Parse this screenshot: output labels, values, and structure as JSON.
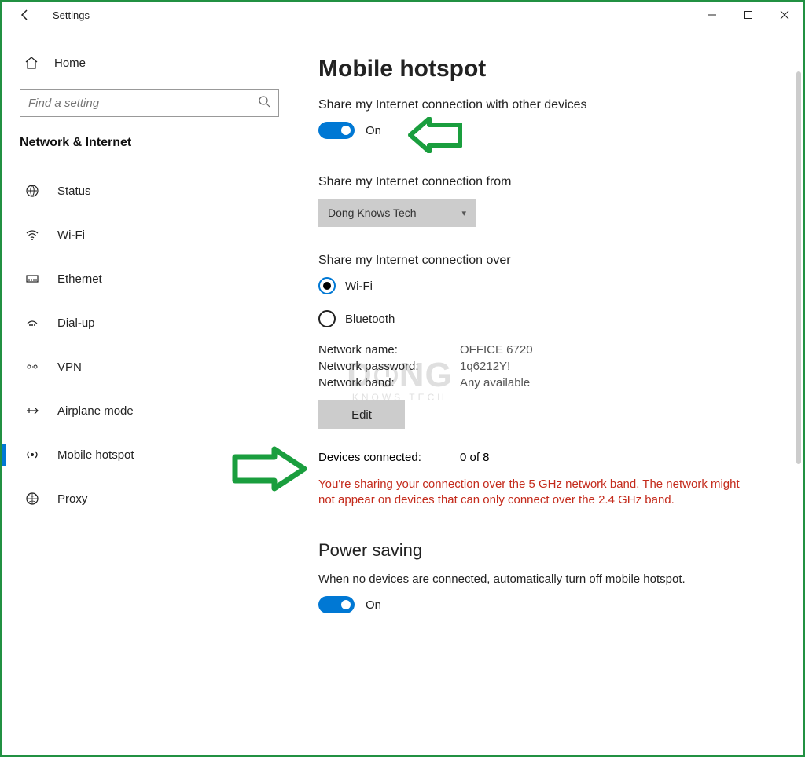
{
  "titlebar": {
    "title": "Settings"
  },
  "sidebar": {
    "home": "Home",
    "search_placeholder": "Find a setting",
    "category": "Network & Internet",
    "items": [
      {
        "label": "Status"
      },
      {
        "label": "Wi-Fi"
      },
      {
        "label": "Ethernet"
      },
      {
        "label": "Dial-up"
      },
      {
        "label": "VPN"
      },
      {
        "label": "Airplane mode"
      },
      {
        "label": "Mobile hotspot"
      },
      {
        "label": "Proxy"
      }
    ]
  },
  "main": {
    "heading": "Mobile hotspot",
    "share_label": "Share my Internet connection with other devices",
    "share_toggle_state": "On",
    "from_label": "Share my Internet connection from",
    "from_value": "Dong Knows Tech",
    "over_label": "Share my Internet connection over",
    "radio_wifi": "Wi-Fi",
    "radio_bluetooth": "Bluetooth",
    "net_name_k": "Network name:",
    "net_name_v": "OFFICE 6720",
    "net_pass_k": "Network password:",
    "net_pass_v": "1q6212Y!",
    "net_band_k": "Network band:",
    "net_band_v": "Any available",
    "edit_label": "Edit",
    "devices_k": "Devices connected:",
    "devices_v": "0 of 8",
    "warning": "You're sharing your connection over the 5 GHz network band. The network might not appear on devices that can only connect over the 2.4 GHz band.",
    "powersave_heading": "Power saving",
    "powersave_desc": "When no devices are connected, automatically turn off mobile hotspot.",
    "powersave_state": "On"
  },
  "watermark": {
    "line1": "DONG",
    "line2": "KNOWS TECH"
  }
}
